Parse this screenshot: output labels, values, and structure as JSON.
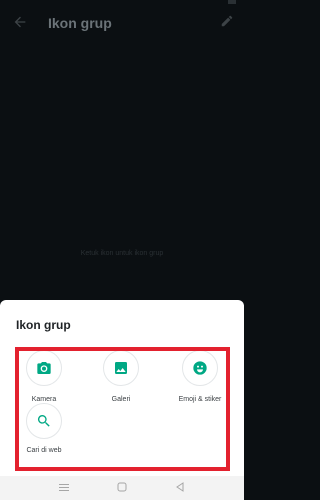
{
  "appbar": {
    "title": "Ikon grup"
  },
  "background": {
    "empty_text": "Ketuk ikon untuk ikon grup"
  },
  "sheet": {
    "title": "Ikon grup",
    "options": [
      {
        "label": "Kamera",
        "icon": "camera-icon"
      },
      {
        "label": "Galeri",
        "icon": "image-icon"
      },
      {
        "label": "Emoji & stiker",
        "icon": "emoji-icon"
      },
      {
        "label": "Cari di web",
        "icon": "search-icon"
      }
    ]
  },
  "colors": {
    "accent": "#00a884",
    "highlight": "#e3212e"
  }
}
